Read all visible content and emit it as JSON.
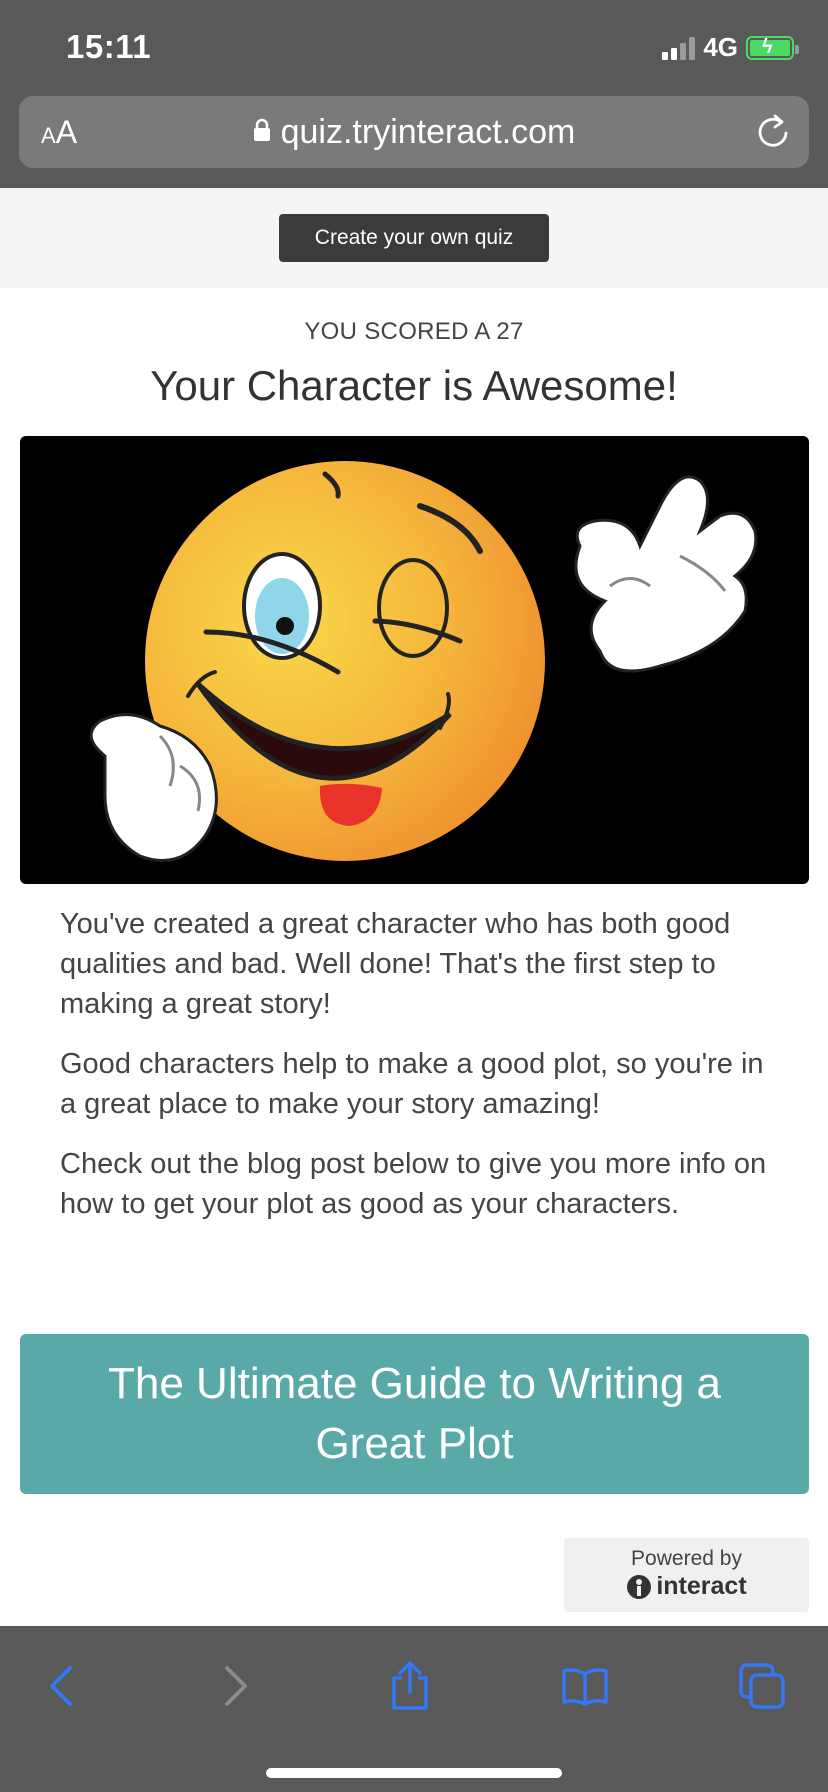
{
  "status_bar": {
    "time": "15:11",
    "network": "4G"
  },
  "address_bar": {
    "text_size_label_small": "A",
    "text_size_label_big": "A",
    "url": "quiz.tryinteract.com"
  },
  "header": {
    "create_quiz_label": "Create your own quiz"
  },
  "result": {
    "score_text": "YOU SCORED A 27",
    "title": "Your Character is Awesome!",
    "paragraphs": [
      "You've created a great character who has both good qualities and bad. Well done! That's the first step to making a great story!",
      "Good characters help to make a good plot, so you're in a great place to make your story amazing!",
      "Check out the blog post below to give you more info on how to get your plot as good as your characters."
    ],
    "guide_button_label": "The Ultimate Guide to Writing a Great Plot"
  },
  "footer": {
    "powered_by": "Powered by",
    "brand": "interact"
  },
  "colors": {
    "chrome": "#595959",
    "guide_button": "#5aa9a9",
    "toolbar_icon": "#3478f6",
    "battery": "#4cd964"
  },
  "toolbar_icons": [
    "back-icon",
    "forward-icon",
    "share-icon",
    "bookmarks-icon",
    "tabs-icon"
  ]
}
